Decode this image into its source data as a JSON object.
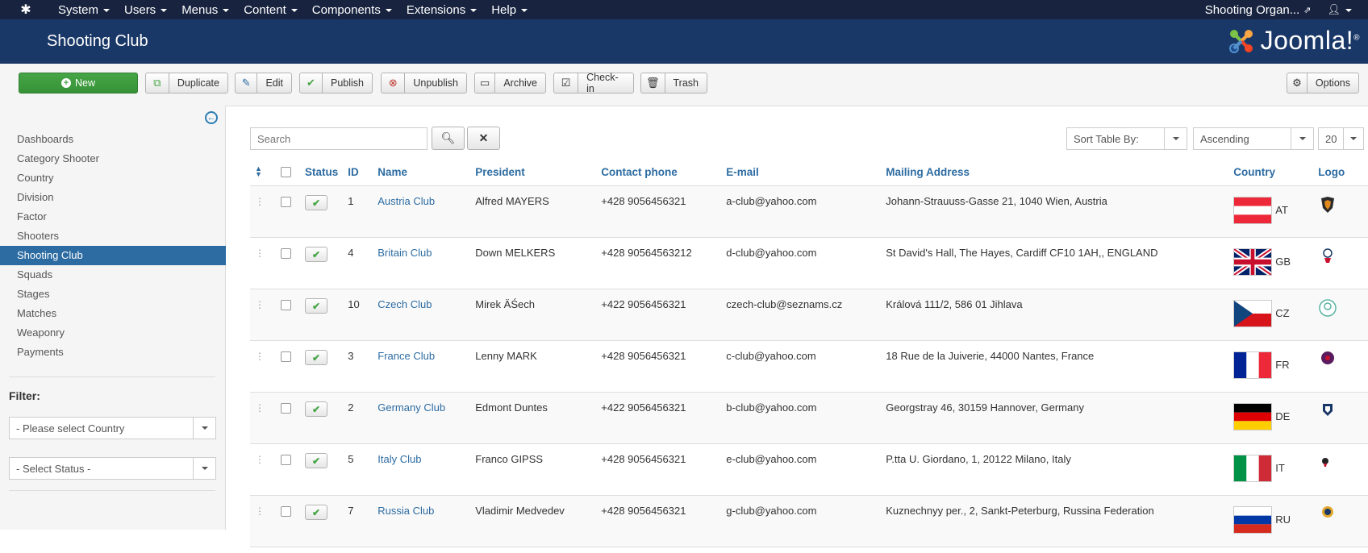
{
  "navbar": {
    "menus": [
      "System",
      "Users",
      "Menus",
      "Content",
      "Components",
      "Extensions",
      "Help"
    ],
    "site_name": "Shooting Organ..."
  },
  "header": {
    "title": "Shooting Club",
    "logo_text": "Joomla!",
    "logo_mark": "®"
  },
  "toolbar": {
    "new": "New",
    "duplicate": "Duplicate",
    "edit": "Edit",
    "publish": "Publish",
    "unpublish": "Unpublish",
    "archive": "Archive",
    "checkin": "Check-in",
    "trash": "Trash",
    "options": "Options"
  },
  "sidebar": {
    "items": [
      "Dashboards",
      "Category Shooter",
      "Country",
      "Division",
      "Factor",
      "Shooters",
      "Shooting Club",
      "Squads",
      "Stages",
      "Matches",
      "Weaponry",
      "Payments"
    ],
    "active": "Shooting Club",
    "filter_label": "Filter:",
    "country_select": "- Please select Country",
    "status_select": "- Select Status -"
  },
  "list": {
    "search_placeholder": "Search",
    "sort_by": "Sort Table By:",
    "order": "Ascending",
    "limit": "20",
    "columns": [
      "Status",
      "ID",
      "Name",
      "President",
      "Contact phone",
      "E-mail",
      "Mailing Address",
      "Country",
      "Logo"
    ],
    "rows": [
      {
        "id": "1",
        "name": "Austria Club",
        "president": "Alfred MAYERS",
        "phone": "+428 9056456321",
        "email": "a-club@yahoo.com",
        "address": "Johann-Strauuss-Gasse 21, 1040 Wien, Austria",
        "country": "AT"
      },
      {
        "id": "4",
        "name": "Britain Club",
        "president": "Down MELKERS",
        "phone": "+428 90564563212",
        "email": "d-club@yahoo.com",
        "address": "St David's Hall, The Hayes, Cardiff CF10 1AH,, ENGLAND",
        "country": "GB"
      },
      {
        "id": "10",
        "name": "Czech Club",
        "president": "Mirek ÄŚech",
        "phone": "+422 9056456321",
        "email": "czech-club@seznams.cz",
        "address": "Králová 111/2, 586 01 Jihlava",
        "country": "CZ"
      },
      {
        "id": "3",
        "name": "France Club",
        "president": "Lenny MARK",
        "phone": "+428 9056456321",
        "email": "c-club@yahoo.com",
        "address": "18 Rue de la Juiverie, 44000 Nantes, France",
        "country": "FR"
      },
      {
        "id": "2",
        "name": "Germany Club",
        "president": "Edmont Duntes",
        "phone": "+422 9056456321",
        "email": "b-club@yahoo.com",
        "address": "Georgstray 46, 30159 Hannover, Germany",
        "country": "DE"
      },
      {
        "id": "5",
        "name": "Italy Club",
        "president": "Franco GIPSS",
        "phone": "+428 9056456321",
        "email": "e-club@yahoo.com",
        "address": "P.tta U. Giordano, 1, 20122 Milano, Italy",
        "country": "IT"
      },
      {
        "id": "7",
        "name": "Russia Club",
        "president": "Vladimir Medvedev",
        "phone": "+428 9056456321",
        "email": "g-club@yahoo.com",
        "address": "Kuznechnyy per., 2, Sankt-Peterburg, Russina Federation",
        "country": "RU"
      }
    ]
  },
  "colors": {
    "navbar": "#17233f",
    "header": "#1a3867",
    "accent_link": "#2d6ca2",
    "new_button": "#46a546"
  }
}
